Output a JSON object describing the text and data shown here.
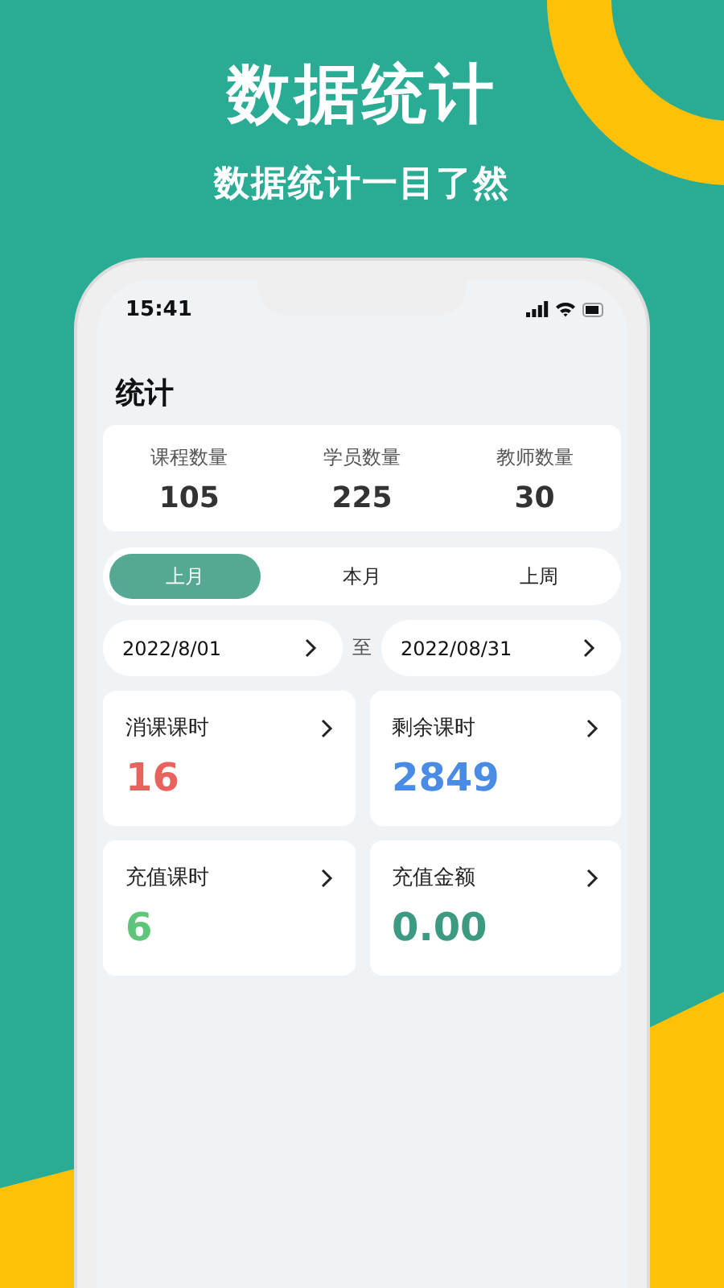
{
  "headline": "数据统计",
  "subtitle": "数据统计一目了然",
  "status_bar": {
    "time": "15:41"
  },
  "page_title": "统计",
  "counts": [
    {
      "label": "课程数量",
      "value": "105"
    },
    {
      "label": "学员数量",
      "value": "225"
    },
    {
      "label": "教师数量",
      "value": "30"
    }
  ],
  "tabs": [
    {
      "label": "上月",
      "selected": true
    },
    {
      "label": "本月",
      "selected": false
    },
    {
      "label": "上周",
      "selected": false
    }
  ],
  "date_range": {
    "start": "2022/8/01",
    "separator": "至",
    "end": "2022/08/31"
  },
  "stats": [
    {
      "label": "消课课时",
      "value": "16",
      "color": "#e8625e"
    },
    {
      "label": "剩余课时",
      "value": "2849",
      "color": "#4a8be6"
    },
    {
      "label": "充值课时",
      "value": "6",
      "color": "#5ec57a"
    },
    {
      "label": "充值金额",
      "value": "0.00",
      "color": "#3b9a80"
    }
  ]
}
